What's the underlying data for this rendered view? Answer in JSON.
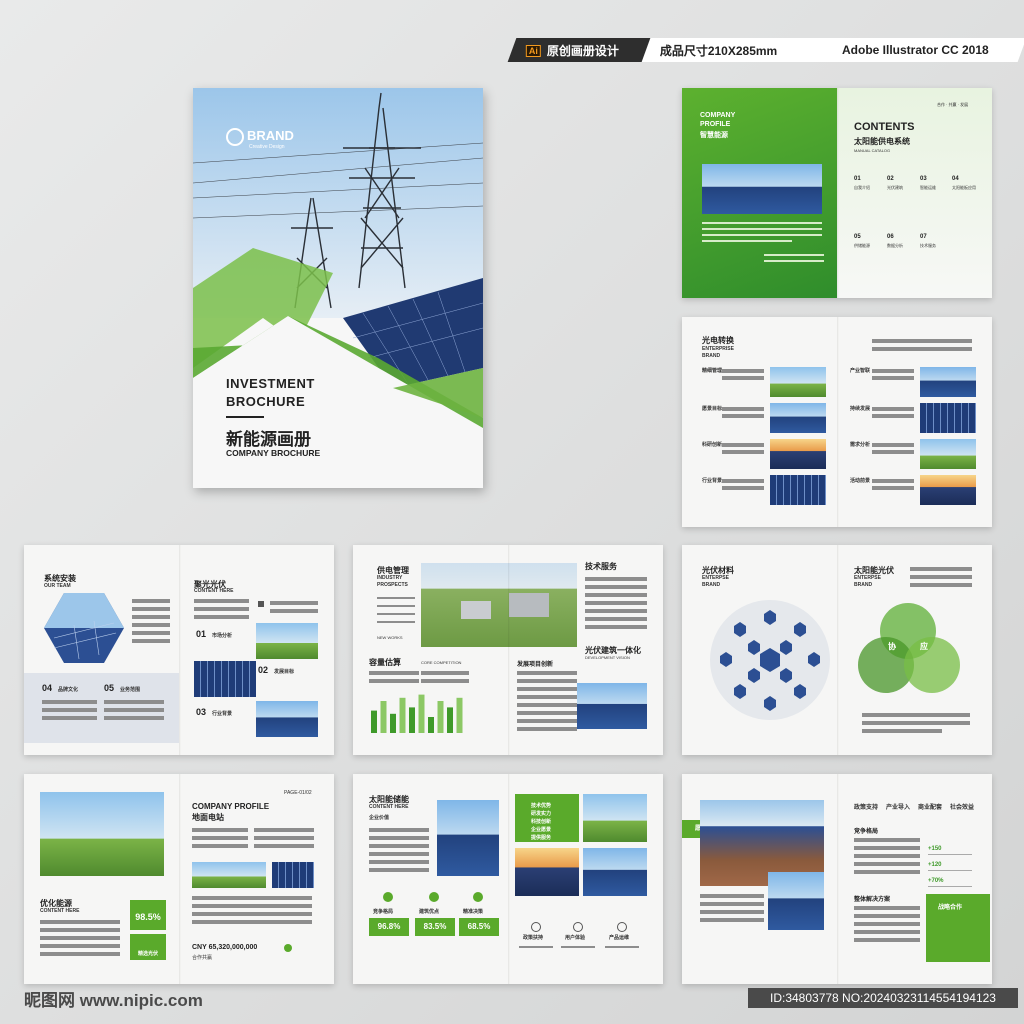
{
  "header": {
    "badge_ai": "Ai",
    "badge_1": "原创画册设计",
    "badge_2": "成品尺寸210X285mm",
    "badge_3": "Adobe Illustrator CC 2018"
  },
  "cover": {
    "brand": "BRAND",
    "brand_sub": "Creative Design",
    "title_line1": "INVESTMENT",
    "title_line2": "BROCHURE",
    "title_cn": "新能源画册",
    "subtitle": "COMPANY BROCHURE"
  },
  "p1": {
    "company": "COMPANY",
    "profile": "PROFILE",
    "cn": "智慧能源",
    "contents": "CONTENTS",
    "contents_cn": "太阳能供电系统",
    "catalog": "MANUAL CATALOG",
    "top_right": "合作 · 共赢 · 发展",
    "items": [
      {
        "no": "01",
        "label": "自我介绍"
      },
      {
        "no": "02",
        "label": "光伏建筑"
      },
      {
        "no": "03",
        "label": "智能运维"
      },
      {
        "no": "04",
        "label": "太阳能板应用"
      },
      {
        "no": "05",
        "label": "供储能源"
      },
      {
        "no": "06",
        "label": "数据分析"
      },
      {
        "no": "07",
        "label": "技术服务"
      }
    ]
  },
  "p2": {
    "title": "光电转换",
    "sub1": "ENTERPRISE",
    "sub2": "BRAND",
    "left_labels": [
      "精细管理",
      "愿景目标",
      "科研创新",
      "行业背景"
    ],
    "right_labels": [
      "产业智联",
      "持续发展",
      "需求分析",
      "活动前景"
    ]
  },
  "p3": {
    "team": "系统安装",
    "team_sub": "OUR TEAM",
    "title": "聚光光伏",
    "title_sub": "CONTENT HERE",
    "items": [
      {
        "no": "01",
        "label": "市场分析"
      },
      {
        "no": "02",
        "label": "发展目标"
      },
      {
        "no": "03",
        "label": "行业背景"
      },
      {
        "no": "04",
        "label": "品牌文化"
      },
      {
        "no": "05",
        "label": "业务范围"
      }
    ]
  },
  "p4": {
    "title": "供电管理",
    "sub1": "INDUSTRY",
    "sub2": "PROSPECTS",
    "tech": "技术服务",
    "capacity": "容量估算",
    "core": "CORE COMPETITION",
    "dev": "发展项目创新",
    "integration": "光伏建筑一体化",
    "dev_vision": "DEVELOPMENT VISION",
    "new_works": "NEW WORKS",
    "bars": [
      14,
      20,
      12,
      22,
      16,
      24,
      10,
      20,
      16,
      22
    ]
  },
  "p5": {
    "title_l": "光伏材料",
    "sub_l1": "ENTERPSE",
    "sub_l2": "BRAND",
    "title_r": "太阳能光伏",
    "sub_r1": "ENTERPSE",
    "sub_r2": "BRAND",
    "venn": [
      "协",
      "应"
    ]
  },
  "p6": {
    "page_no": "PAGE-01/02",
    "left_title": "优化能源",
    "left_sub": "CONTENT HERE",
    "title1": "COMPANY PROFILE",
    "title2": "地面电站",
    "stat": "98.5%",
    "stat_label": "精选光伏",
    "cny": "CNY 65,320,000,000",
    "cny_label": "合作共赢"
  },
  "p7": {
    "title": "太阳能储能",
    "sub": "CONTENT HERE",
    "value_label": "企业价值",
    "list": [
      "技术优势",
      "研发实力",
      "科技创新",
      "企业愿景",
      "提供服务"
    ],
    "stats": [
      {
        "label": "竞争格局",
        "value": "96.8%"
      },
      {
        "label": "建筑优点",
        "value": "83.5%"
      },
      {
        "label": "精准决策",
        "value": "68.5%"
      }
    ],
    "icons": [
      {
        "label": "政策扶持"
      },
      {
        "label": "用户体验"
      },
      {
        "label": "产品运维"
      }
    ]
  },
  "p8": {
    "tab": "愿景目标",
    "nav": [
      "政策支持",
      "产业导入",
      "商业配套",
      "社会效益"
    ],
    "compete": "竞争格局",
    "solution": "整体解决方案",
    "stats": [
      "+150",
      "+120",
      "+70%"
    ],
    "strategy": "战略合作"
  },
  "watermark": {
    "left": "昵图网 www.nipic.com",
    "right": "ID:34803778 NO:20240323114554194123"
  }
}
